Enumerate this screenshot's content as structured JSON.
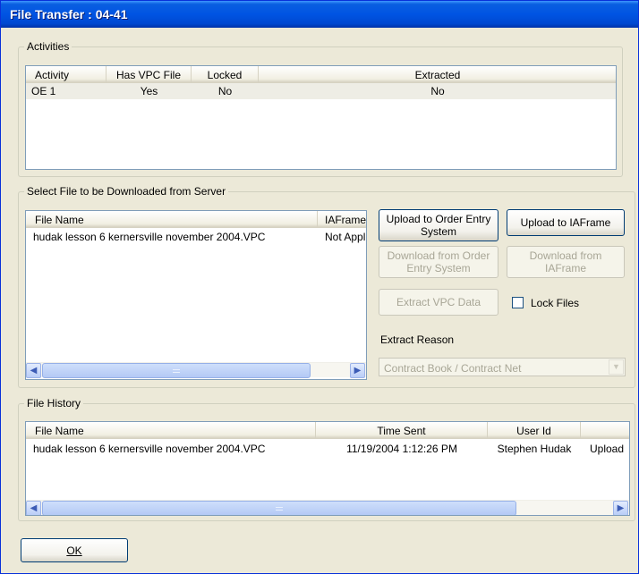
{
  "window": {
    "title": "File Transfer : 04-41"
  },
  "activities": {
    "label": "Activities",
    "columns": [
      "Activity",
      "Has VPC File",
      "Locked",
      "Extracted"
    ],
    "rows": [
      {
        "activity": "OE 1",
        "has_vpc": "Yes",
        "locked": "No",
        "extracted": "No"
      }
    ]
  },
  "download": {
    "label": "Select File to be Downloaded from Server",
    "columns": [
      "File Name",
      "IAFrame"
    ],
    "rows": [
      {
        "file_name": "hudak lesson 6 kernersville november 2004.VPC",
        "iaframe": "Not Applicable"
      }
    ],
    "buttons": {
      "upload_oe": "Upload to Order Entry System",
      "upload_iaframe": "Upload to IAFrame",
      "download_oe": "Download from Order Entry System",
      "download_iaframe": "Download from IAFrame",
      "extract_vpc": "Extract VPC Data"
    },
    "lock_files_label": "Lock Files",
    "lock_files_checked": false,
    "extract_reason_label": "Extract Reason",
    "extract_reason_value": "Contract Book / Contract Net"
  },
  "history": {
    "label": "File History",
    "columns": [
      "File Name",
      "Time Sent",
      "User Id",
      ""
    ],
    "rows": [
      {
        "file_name": "hudak lesson 6 kernersville november 2004.VPC",
        "time_sent": "11/19/2004 1:12:26 PM",
        "user_id": "Stephen Hudak",
        "action": "Upload"
      }
    ]
  },
  "ok_button": "OK",
  "icons": {
    "scroll_left": "◀",
    "scroll_right": "▶",
    "dropdown": "▼"
  }
}
